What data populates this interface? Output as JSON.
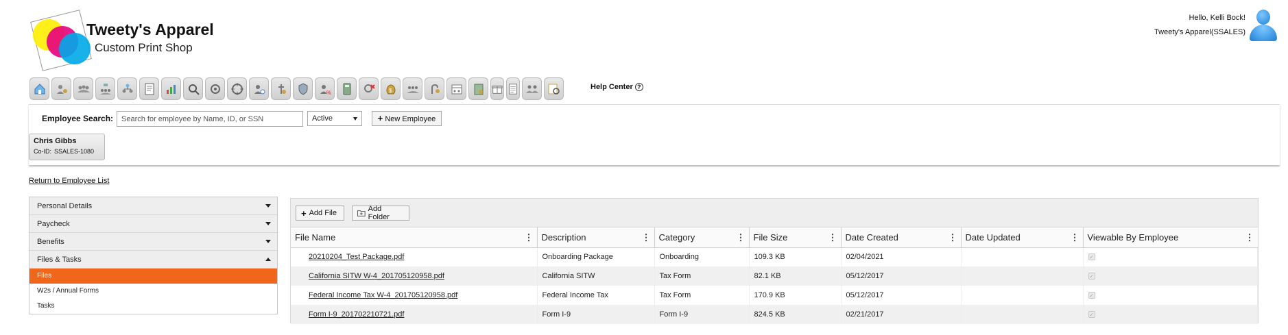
{
  "brand": {
    "name": "Tweety's Apparel",
    "tagline": "Custom Print Shop"
  },
  "user": {
    "greeting": "Hello, Kelli Bock!",
    "company": "Tweety's Apparel(SSALES)"
  },
  "toolbar": {
    "icons": [
      "home-icon",
      "employee-settings-icon",
      "employees-group-icon",
      "org-chart-icon",
      "employee-tree-icon",
      "document-icon",
      "report-chart-icon",
      "search-people-icon",
      "target-icon",
      "target-alt-icon",
      "time-icon",
      "direct-deposit-icon",
      "security-shield-icon",
      "tax-icon",
      "calculator-icon",
      "terminate-icon",
      "money-bag-icon",
      "payroll-group-icon",
      "benefits-icon",
      "schedule-icon",
      "ledger-icon",
      "gift-icon",
      "notes-icon",
      "team-icon",
      "reports-icon"
    ],
    "help_label": "Help Center",
    "help_glyph": "?"
  },
  "employee_search": {
    "label": "Employee Search:",
    "placeholder": "Search for employee by Name, ID, or SSN",
    "status_value": "Active",
    "new_employee_label": "New Employee"
  },
  "employee_card": {
    "name": "Chris Gibbs",
    "co_id_label": "Co-ID:",
    "co_id": "SSALES-1080"
  },
  "return_link": "Return to Employee List",
  "nav": {
    "sections": [
      {
        "label": "Personal Details",
        "expanded": false
      },
      {
        "label": "Paycheck",
        "expanded": false
      },
      {
        "label": "Benefits",
        "expanded": false
      },
      {
        "label": "Files & Tasks",
        "expanded": true
      }
    ],
    "sub_items": [
      {
        "label": "Files",
        "active": true
      },
      {
        "label": "W2s / Annual Forms",
        "active": false
      },
      {
        "label": "Tasks",
        "active": false
      }
    ]
  },
  "files": {
    "add_file_label": "Add File",
    "add_folder_label": "Add Folder",
    "columns": [
      "File Name",
      "Description",
      "Category",
      "File Size",
      "Date Created",
      "Date Updated",
      "Viewable By Employee"
    ],
    "rows": [
      {
        "file_name": "20210204_Test Package.pdf",
        "description": "Onboarding Package",
        "category": "Onboarding",
        "file_size": "109.3 KB",
        "date_created": "02/04/2021",
        "date_updated": "",
        "viewable": true
      },
      {
        "file_name": "California SITW W-4_201705120958.pdf",
        "description": "California SITW",
        "category": "Tax Form",
        "file_size": "82.1 KB",
        "date_created": "05/12/2017",
        "date_updated": "",
        "viewable": true
      },
      {
        "file_name": "Federal Income Tax W-4_201705120958.pdf",
        "description": "Federal Income Tax",
        "category": "Tax Form",
        "file_size": "170.9 KB",
        "date_created": "05/12/2017",
        "date_updated": "",
        "viewable": true
      },
      {
        "file_name": "Form I-9_201702210721.pdf",
        "description": "Form I-9",
        "category": "Form I-9",
        "file_size": "824.5 KB",
        "date_created": "02/21/2017",
        "date_updated": "",
        "viewable": true
      }
    ]
  }
}
